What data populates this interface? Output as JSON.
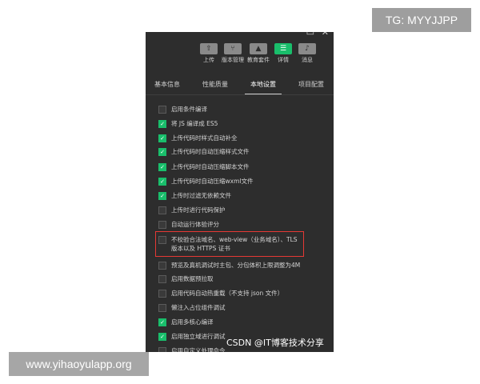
{
  "overlay": {
    "top_badge": "TG: MYYJJPP",
    "bottom_badge": "www.yihaoyulapp.org",
    "watermark": "CSDN @IT博客技术分享"
  },
  "toolbar": {
    "items": [
      {
        "label": "上传",
        "icon": "upload-icon"
      },
      {
        "label": "版本管理",
        "icon": "branch-icon"
      },
      {
        "label": "教育套件",
        "icon": "graduation-cap-icon"
      },
      {
        "label": "详情",
        "icon": "list-icon",
        "active": true
      },
      {
        "label": "消息",
        "icon": "bell-icon"
      }
    ],
    "accent_color": "#19be6b"
  },
  "tabs": [
    {
      "label": "基本信息"
    },
    {
      "label": "性能质量"
    },
    {
      "label": "本地设置",
      "active": true
    },
    {
      "label": "项目配置"
    }
  ],
  "settings": [
    {
      "label": "启用条件编译",
      "checked": false
    },
    {
      "label": "将 JS 编译成 ES5",
      "checked": true
    },
    {
      "label": "上传代码时样式自动补全",
      "checked": true
    },
    {
      "label": "上传代码时自动压缩样式文件",
      "checked": true
    },
    {
      "label": "上传代码时自动压缩脚本文件",
      "checked": true
    },
    {
      "label": "上传代码时自动压缩wxml文件",
      "checked": true
    },
    {
      "label": "上传时过滤无依赖文件",
      "checked": true
    },
    {
      "label": "上传时进行代码保护",
      "checked": false
    },
    {
      "label": "自动运行体验评分",
      "checked": false
    },
    {
      "label": "不校验合法域名、web-view（业务域名）、TLS",
      "label2": "版本以及 HTTPS 证书",
      "checked": false,
      "highlighted": true
    },
    {
      "label": "预览及真机调试时主包、分包体积上限调整为4M",
      "checked": false
    },
    {
      "label": "启用数据预拉取",
      "checked": false
    },
    {
      "label": "启用代码自动热重载（不支持 json 文件）",
      "checked": false
    },
    {
      "label": "懒注入占位组件调试",
      "checked": false
    },
    {
      "label": "启用多核心编译",
      "checked": true
    },
    {
      "label": "启用独立域进行调试",
      "checked": true
    },
    {
      "label": "启用自定义处理命令",
      "checked": false
    }
  ]
}
